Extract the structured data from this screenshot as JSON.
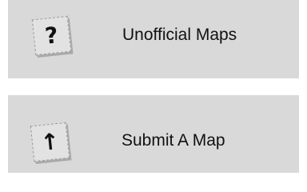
{
  "menu": {
    "items": [
      {
        "label": "Unofficial Maps",
        "icon": "question-mark-icon",
        "glyph": "?"
      },
      {
        "label": "Submit A Map",
        "icon": "arrow-up-icon",
        "glyph": "↑"
      }
    ]
  },
  "colors": {
    "card_background": "#d9d9d9",
    "page_background": "#ffffff",
    "text": "#111111"
  }
}
